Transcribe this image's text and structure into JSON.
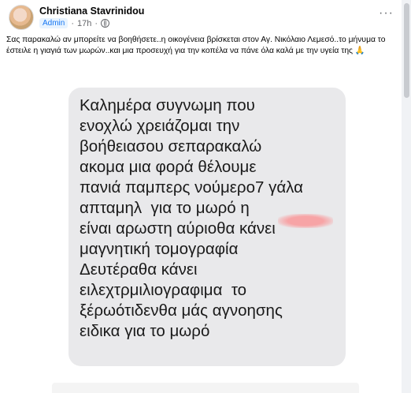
{
  "post": {
    "author": "Christiana Stavrinidou",
    "role_badge": "Admin",
    "time": "17h",
    "more_icon": "more-horizontal-icon",
    "caption": "Σας παρακαλώ αν μπορείτε να βοηθήσετε..η οικογένεια βρίσκεται στον Αγ. Νικόλαιο Λεμεσό..το μήνυμα το έστειλε η γιαγιά των μωρών..και μια προσευχή για την κοπέλα να πάνε όλα καλά με την υγεία της 🙏"
  },
  "message": {
    "lines": [
      "Καλημέρα συγνωμη που",
      "ενοχλώ χρειάζομαι την",
      "βοήθειασου σεπαρακαλώ",
      "ακομα μια φορά θέλουμε",
      "πανιά παμπερς νούμερο7 γάλα",
      "απταμηλ  για το μωρό η",
      "είναι αρωστη αύριοθα κάνει",
      "μαγνητική τομογραφία",
      "Δευτέραθα κάνει",
      "ειλεχτρμιλιογραφιμα  το",
      "ξέρωότιδενθα μάς αγνοησης",
      "ειδικα για το μωρό"
    ]
  }
}
